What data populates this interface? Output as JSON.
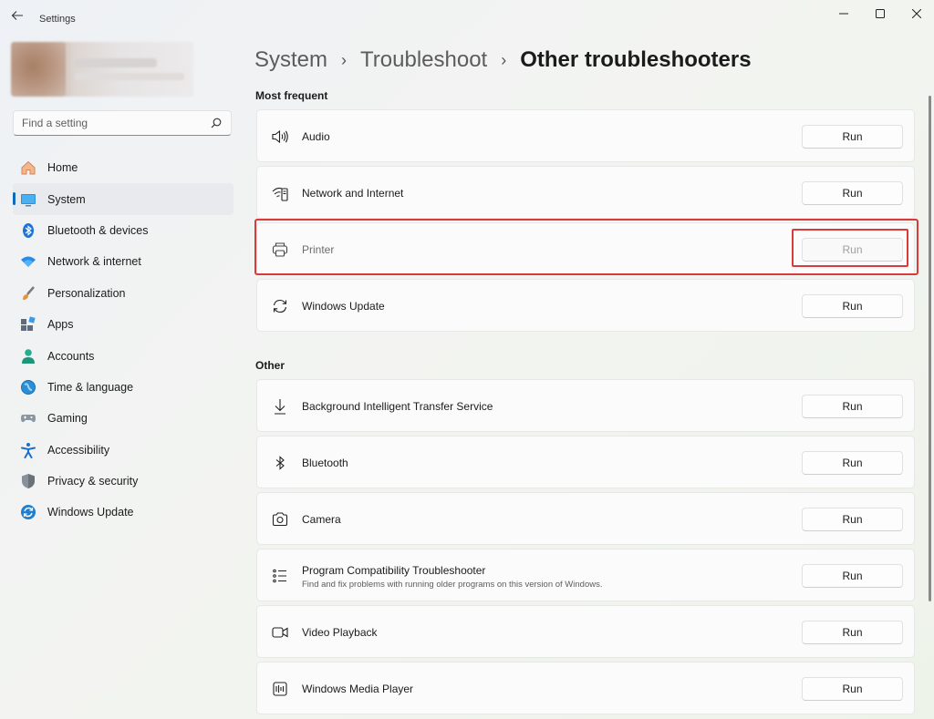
{
  "window": {
    "title": "Settings"
  },
  "search": {
    "placeholder": "Find a setting"
  },
  "nav": {
    "items": [
      {
        "label": "Home",
        "icon": "home-icon"
      },
      {
        "label": "System",
        "icon": "system-icon",
        "active": true
      },
      {
        "label": "Bluetooth & devices",
        "icon": "bluetooth-icon"
      },
      {
        "label": "Network & internet",
        "icon": "wifi-icon"
      },
      {
        "label": "Personalization",
        "icon": "brush-icon"
      },
      {
        "label": "Apps",
        "icon": "apps-icon"
      },
      {
        "label": "Accounts",
        "icon": "person-icon"
      },
      {
        "label": "Time & language",
        "icon": "globe-icon"
      },
      {
        "label": "Gaming",
        "icon": "gamepad-icon"
      },
      {
        "label": "Accessibility",
        "icon": "accessibility-icon"
      },
      {
        "label": "Privacy & security",
        "icon": "shield-icon"
      },
      {
        "label": "Windows Update",
        "icon": "update-icon"
      }
    ]
  },
  "breadcrumb": {
    "items": [
      "System",
      "Troubleshoot"
    ],
    "current": "Other troubleshooters"
  },
  "sections": {
    "most_frequent": {
      "title": "Most frequent",
      "items": [
        {
          "label": "Audio",
          "icon": "speaker-icon",
          "button": "Run"
        },
        {
          "label": "Network and Internet",
          "icon": "network-icon",
          "button": "Run"
        },
        {
          "label": "Printer",
          "icon": "printer-icon",
          "button": "Run",
          "disabled": true
        },
        {
          "label": "Windows Update",
          "icon": "refresh-icon",
          "button": "Run"
        }
      ]
    },
    "other": {
      "title": "Other",
      "items": [
        {
          "label": "Background Intelligent Transfer Service",
          "icon": "download-icon",
          "button": "Run"
        },
        {
          "label": "Bluetooth",
          "icon": "bluetooth-outline-icon",
          "button": "Run"
        },
        {
          "label": "Camera",
          "icon": "camera-icon",
          "button": "Run"
        },
        {
          "label": "Program Compatibility Troubleshooter",
          "description": "Find and fix problems with running older programs on this version of Windows.",
          "icon": "list-icon",
          "button": "Run"
        },
        {
          "label": "Video Playback",
          "icon": "video-icon",
          "button": "Run"
        },
        {
          "label": "Windows Media Player",
          "icon": "media-player-icon",
          "button": "Run"
        }
      ]
    }
  },
  "colors": {
    "accent": "#0f6cbd",
    "highlight": "#d93a3a"
  }
}
